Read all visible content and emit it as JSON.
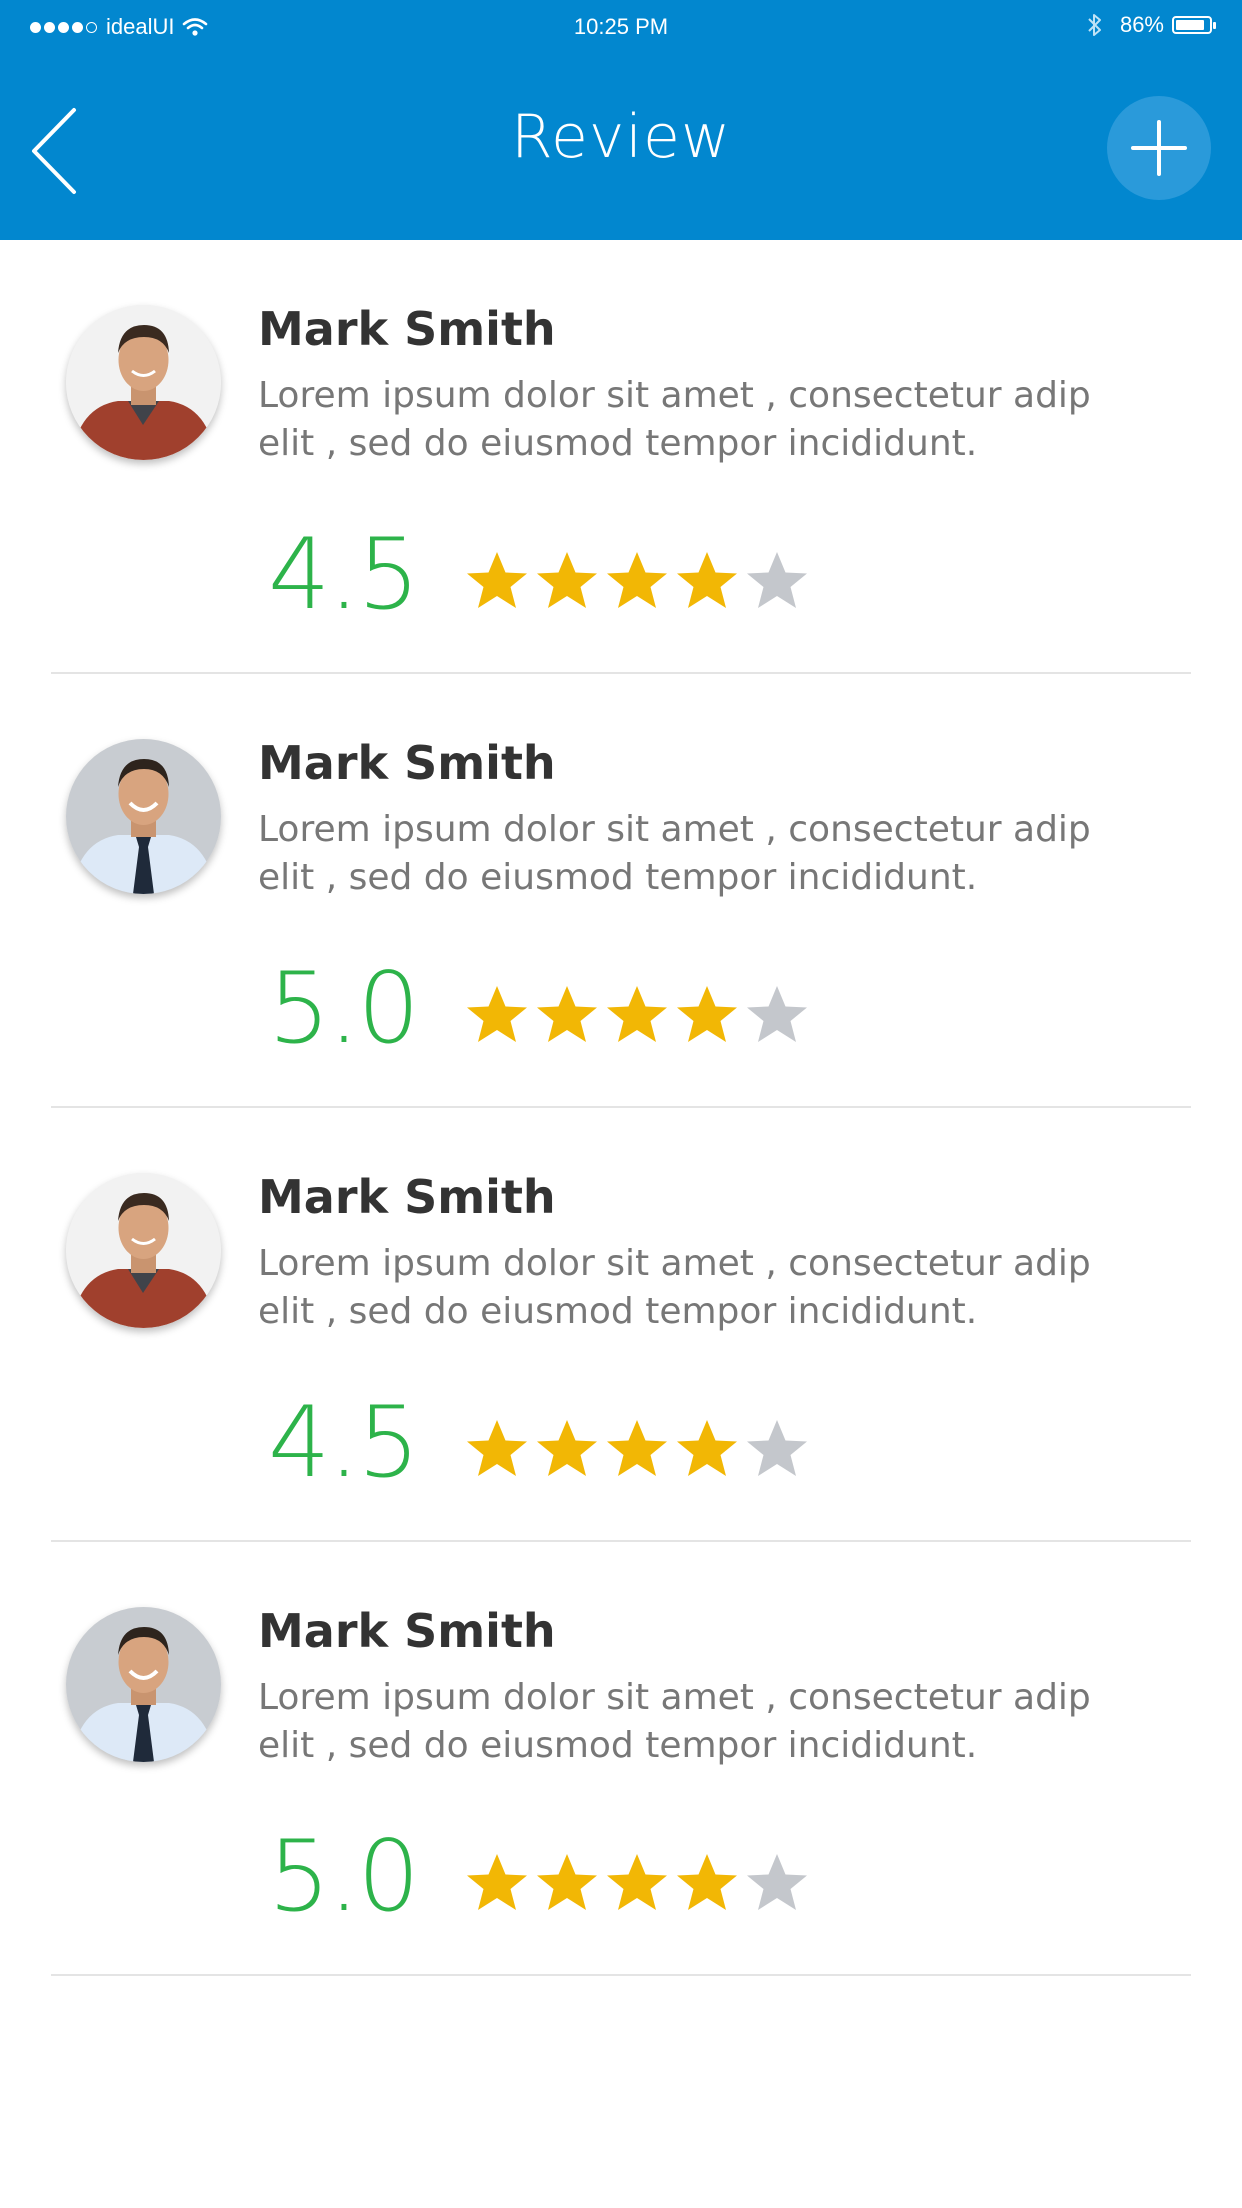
{
  "status_bar": {
    "carrier": "idealUI",
    "time": "10:25 PM",
    "battery": "86%"
  },
  "nav": {
    "title": "Review",
    "back_icon": "chevron-left-icon",
    "add_icon": "plus-icon"
  },
  "colors": {
    "brand": "#0287cf",
    "score": "#2db34a",
    "star_on": "#f2b705",
    "star_off": "#c4c7cc"
  },
  "reviews": [
    {
      "name": "Mark Smith",
      "text_line1": "Lorem ipsum dolor sit amet , consectetur adip",
      "text_line2": "elit , sed do eiusmod tempor incididunt.",
      "score": "4.5",
      "stars_filled": 4,
      "stars_total": 5,
      "avatar": "avatar-red-shirt"
    },
    {
      "name": "Mark Smith",
      "text_line1": "Lorem ipsum dolor sit amet , consectetur adip",
      "text_line2": "elit , sed do eiusmod tempor incididunt.",
      "score": "5.0",
      "stars_filled": 4,
      "stars_total": 5,
      "avatar": "avatar-shirt-tie"
    },
    {
      "name": "Mark Smith",
      "text_line1": "Lorem ipsum dolor sit amet , consectetur adip",
      "text_line2": "elit , sed do eiusmod tempor incididunt.",
      "score": "4.5",
      "stars_filled": 4,
      "stars_total": 5,
      "avatar": "avatar-red-shirt"
    },
    {
      "name": "Mark Smith",
      "text_line1": "Lorem ipsum dolor sit amet , consectetur adip",
      "text_line2": "elit , sed do eiusmod tempor incididunt.",
      "score": "5.0",
      "stars_filled": 4,
      "stars_total": 5,
      "avatar": "avatar-shirt-tie"
    }
  ]
}
